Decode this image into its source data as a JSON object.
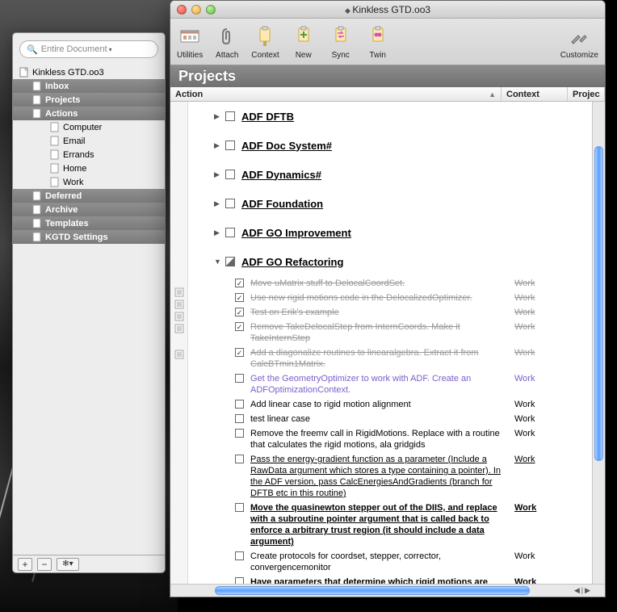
{
  "secondary": {
    "search_placeholder": "Entire Document",
    "root_label": "Kinkless GTD.oo3",
    "items": [
      {
        "label": "Inbox",
        "depth": 1,
        "selected": true
      },
      {
        "label": "Projects",
        "depth": 1,
        "selected": true
      },
      {
        "label": "Actions",
        "depth": 1,
        "selected": true
      },
      {
        "label": "Computer",
        "depth": 2,
        "selected": false
      },
      {
        "label": "Email",
        "depth": 2,
        "selected": false
      },
      {
        "label": "Errands",
        "depth": 2,
        "selected": false
      },
      {
        "label": "Home",
        "depth": 2,
        "selected": false
      },
      {
        "label": "Work",
        "depth": 2,
        "selected": false
      },
      {
        "label": "Deferred",
        "depth": 1,
        "selected": true
      },
      {
        "label": "Archive",
        "depth": 1,
        "selected": true
      },
      {
        "label": "Templates",
        "depth": 1,
        "selected": true
      },
      {
        "label": "KGTD Settings",
        "depth": 1,
        "selected": true
      }
    ],
    "footer": {
      "add": "+",
      "remove": "−",
      "gear": "✻▾"
    }
  },
  "main": {
    "title": "Kinkless GTD.oo3",
    "toolbar": [
      {
        "id": "utilities",
        "label": "Utilities"
      },
      {
        "id": "attach",
        "label": "Attach"
      },
      {
        "id": "context",
        "label": "Context"
      },
      {
        "id": "new",
        "label": "New"
      },
      {
        "id": "sync",
        "label": "Sync"
      },
      {
        "id": "twin",
        "label": "Twin"
      }
    ],
    "toolbar_right": {
      "id": "customize",
      "label": "Customize"
    },
    "section_title": "Projects",
    "columns": {
      "action": "Action",
      "context": "Context",
      "project": "Projec"
    },
    "projects": [
      {
        "name": "ADF DFTB",
        "expanded": false
      },
      {
        "name": "ADF Doc System#",
        "expanded": false
      },
      {
        "name": "ADF Dynamics#",
        "expanded": false
      },
      {
        "name": "ADF Foundation",
        "expanded": false
      },
      {
        "name": "ADF GO Improvement",
        "expanded": false
      },
      {
        "name": "ADF GO Refactoring",
        "expanded": true,
        "tasks": [
          {
            "text": "Move uMatrix stuff to DelocalCoordSet.",
            "context": "Work",
            "state": "done"
          },
          {
            "text": "Use new rigid motions code in the DelocalizedOptimizer.",
            "context": "Work",
            "state": "done"
          },
          {
            "text": "Test on Erik's example",
            "context": "Work",
            "state": "done"
          },
          {
            "text": "Remove TakeDelocalStep from InternCoords. Make it TakeInternStep",
            "context": "Work",
            "state": "done"
          },
          {
            "text": "Add a diagonalize routines to linearalgebra. Extract it from CalcBTmin1Matrix.",
            "context": "Work",
            "state": "done"
          },
          {
            "text": "Get the GeometryOptimizer to work with ADF. Create an ADFOptimizationContext.",
            "context": "Work",
            "state": "active"
          },
          {
            "text": "Add linear case to rigid motion alignment",
            "context": "Work",
            "state": "normal"
          },
          {
            "text": "test linear case",
            "context": "Work",
            "state": "normal"
          },
          {
            "text": "Remove the freemv call in RigidMotions. Replace with a routine that calculates the rigid motions, ala gridgids",
            "context": "Work",
            "state": "normal"
          },
          {
            "text": "Pass the energy-gradient function as a parameter (Include a RawData argument which stores a type containing a pointer). In the ADF version, pass CalcEnergiesAndGradients (branch for DFTB etc in this routine)",
            "context": "Work",
            "state": "under"
          },
          {
            "text": "Move the quasinewton stepper out of the DIIS, and replace with a subroutine pointer argument that is called back to enforce a arbitrary trust region (it should include a data argument)",
            "context": "Work",
            "state": "bold"
          },
          {
            "text": "Create protocols for coordset, stepper, corrector, convergencemonitor",
            "context": "Work",
            "state": "normal"
          },
          {
            "text": "Have parameters that determine which rigid motions are projected out",
            "context": "Work",
            "state": "bold"
          }
        ]
      }
    ]
  }
}
